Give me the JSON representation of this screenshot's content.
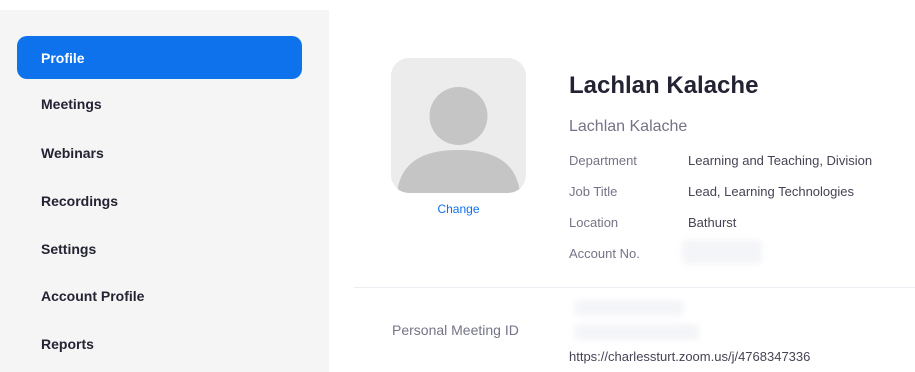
{
  "sidebar": {
    "items": [
      {
        "label": "Profile",
        "active": true
      },
      {
        "label": "Meetings",
        "active": false
      },
      {
        "label": "Webinars",
        "active": false
      },
      {
        "label": "Recordings",
        "active": false
      },
      {
        "label": "Settings",
        "active": false
      },
      {
        "label": "Account Profile",
        "active": false
      },
      {
        "label": "Reports",
        "active": false
      }
    ]
  },
  "profile": {
    "avatar_icon": "user-silhouette-icon",
    "change_label": "Change",
    "full_name": "Lachlan Kalache",
    "display_name": "Lachlan Kalache",
    "fields": [
      {
        "label": "Department",
        "value": "Learning and Teaching, Division"
      },
      {
        "label": "Job Title",
        "value": "Lead, Learning Technologies"
      },
      {
        "label": "Location",
        "value": "Bathurst"
      },
      {
        "label": "Account No.",
        "value": ""
      }
    ]
  },
  "meeting": {
    "pmi_label": "Personal Meeting ID",
    "pmi_url": "https://charlessturt.zoom.us/j/4768347336"
  },
  "colors": {
    "accent": "#0e72ed",
    "sidebar_bg": "#f5f5f5",
    "avatar_bg": "#ececec",
    "avatar_fg": "#c5c5c5"
  }
}
